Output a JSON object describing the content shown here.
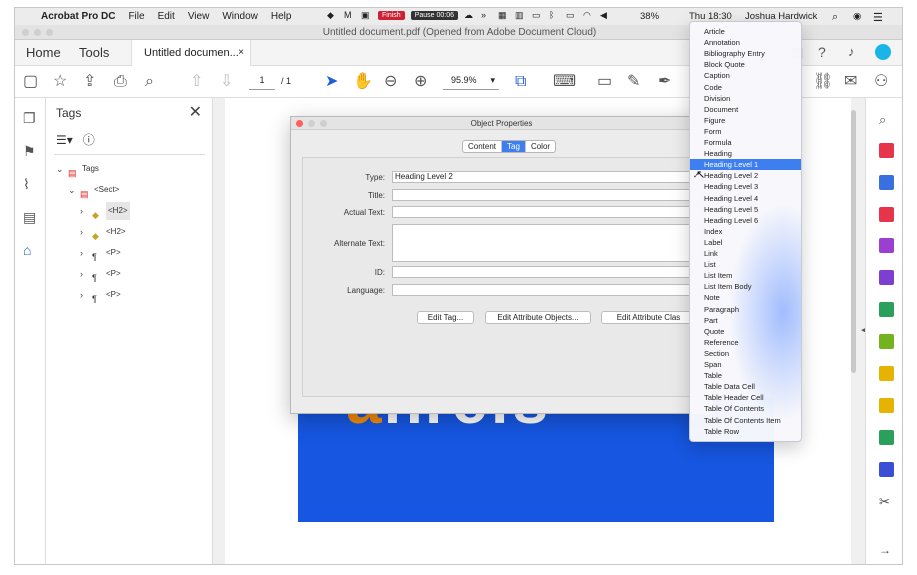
{
  "menubar": {
    "app_name": "Acrobat Pro DC",
    "menus": [
      "File",
      "Edit",
      "View",
      "Window",
      "Help"
    ],
    "tray": {
      "finish_label": "Finish",
      "pause_label": "Pause 00:06",
      "battery": "38%",
      "clock": "Thu 18:30",
      "user": "Joshua Hardwick"
    }
  },
  "window": {
    "title": "Untitled document.pdf (Opened from Adobe Document Cloud)"
  },
  "tabs": {
    "home": "Home",
    "tools": "Tools",
    "document": "Untitled documen...",
    "close_glyph": "×"
  },
  "toolbar": {
    "page_current": "1",
    "page_total": "/ 1",
    "zoom": "95.9%"
  },
  "tags_panel": {
    "title": "Tags",
    "close_glyph": "✕",
    "tree": [
      {
        "label": "Tags",
        "depth": 0,
        "chevron": "⌄",
        "icon": "pdf-tags-icon"
      },
      {
        "label": "<Sect>",
        "depth": 1,
        "chevron": "⌄",
        "icon": "pdf-tag-icon"
      },
      {
        "label": "<H2>",
        "depth": 2,
        "chevron": "›",
        "icon": "tag-icon",
        "selected": true
      },
      {
        "label": "<H2>",
        "depth": 2,
        "chevron": "›",
        "icon": "tag-icon"
      },
      {
        "label": "<P>",
        "depth": 2,
        "chevron": "›",
        "icon": "paragraph-icon"
      },
      {
        "label": "<P>",
        "depth": 2,
        "chevron": "›",
        "icon": "paragraph-icon"
      },
      {
        "label": "<P>",
        "depth": 2,
        "chevron": "›",
        "icon": "paragraph-icon"
      }
    ]
  },
  "document": {
    "big_text_orange": "a",
    "big_text_white": "hrefs"
  },
  "dialog": {
    "title": "Object Properties",
    "tabs": [
      "Content",
      "Tag",
      "Color"
    ],
    "active_tab": "Tag",
    "fields": {
      "type_label": "Type:",
      "type_value": "Heading Level 2",
      "title_label": "Title:",
      "actual_text_label": "Actual Text:",
      "alternate_text_label": "Alternate Text:",
      "id_label": "ID:",
      "language_label": "Language:"
    },
    "buttons": [
      "Edit Tag...",
      "Edit Attribute Objects...",
      "Edit Attribute Clas"
    ]
  },
  "type_menu": {
    "items": [
      "Article",
      "Annotation",
      "Bibliography Entry",
      "Block Quote",
      "Caption",
      "Code",
      "Division",
      "Document",
      "Figure",
      "Form",
      "Formula",
      "Heading",
      "Heading Level 1",
      "Heading Level 2",
      "Heading Level 3",
      "Heading Level 4",
      "Heading Level 5",
      "Heading Level 6",
      "Index",
      "Label",
      "Link",
      "List",
      "List Item",
      "List Item Body",
      "Note",
      "Paragraph",
      "Part",
      "Quote",
      "Reference",
      "Section",
      "Span",
      "Table",
      "Table Data Cell",
      "Table Header Cell",
      "Table Of Contents",
      "Table Of Contents Item",
      "Table Row"
    ],
    "highlighted": "Heading Level 1",
    "checked": "Heading Level 2",
    "check_glyph": "✓"
  },
  "colors": {
    "accent": "#3d7ef0",
    "doc_blue": "#1656e0",
    "orange": "#f28a0a"
  }
}
